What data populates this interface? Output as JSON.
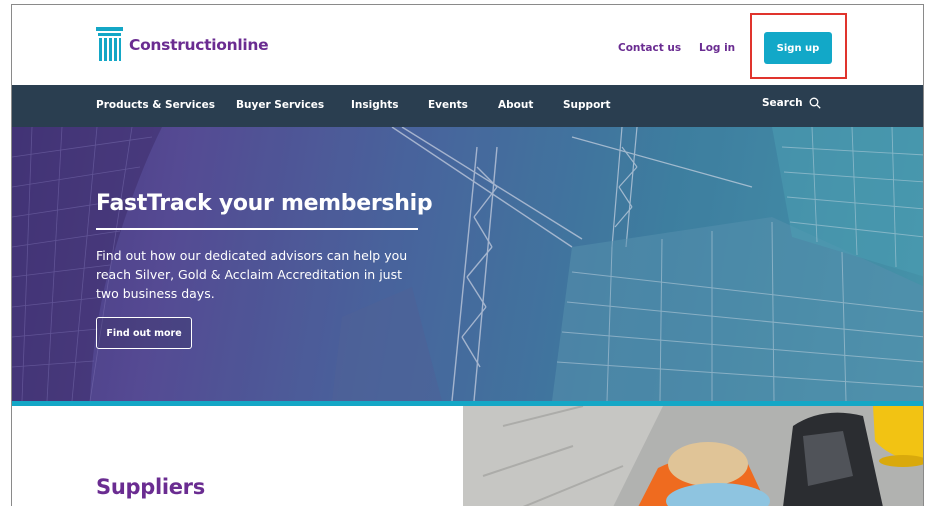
{
  "header": {
    "logo_text": "Constructionline",
    "contact_label": "Contact us",
    "login_label": "Log in",
    "signup_label": "Sign up"
  },
  "nav": {
    "items": [
      "Products & Services",
      "Buyer Services",
      "Insights",
      "Events",
      "About",
      "Support"
    ],
    "search_label": "Search",
    "search_icon": "search-icon"
  },
  "hero": {
    "title": "FastTrack your membership",
    "body": "Find out how our dedicated advisors can help you reach Silver, Gold & Acclaim Accreditation in just two business days.",
    "cta_label": "Find out more"
  },
  "section": {
    "title": "Suppliers"
  },
  "colors": {
    "brand_purple": "#6a2c91",
    "accent_teal": "#12a8c8",
    "nav_bg": "#2a3e50",
    "highlight_red": "#e0342d"
  }
}
